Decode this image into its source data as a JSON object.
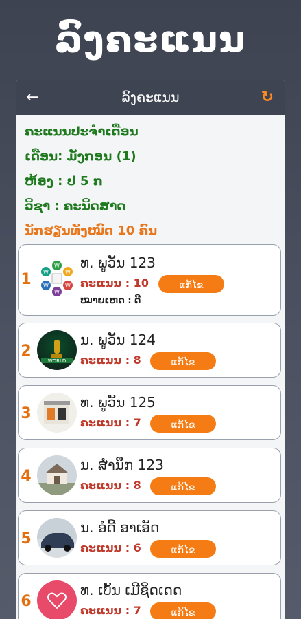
{
  "hero_title": "ລົງຄະແນນ",
  "appbar": {
    "back": "←",
    "title": "ລົງຄະແນນ",
    "refresh": "↻"
  },
  "info": {
    "monthly_heading": "ຄະແນນປະຈຳເດືອນ",
    "month": "ເດືອນ: ມັງກອນ (1)",
    "room": "ຫ້ອງ : ປ 5 ກ",
    "subject": "ວິຊາ :  ຄະນິດສາດ",
    "total_students": "ນັກຮຽນທັງໝົດ 10 ຄົນ"
  },
  "students": [
    {
      "no": "1",
      "name": "ທ. ພູວັນ 123",
      "score": "ຄະແນນ : 10",
      "edit": "ແກ້ໄຂ",
      "note": "ໝາຍເຫດ : ດີ"
    },
    {
      "no": "2",
      "name": "ນ. ພູວັນ 124",
      "score": "ຄະແນນ : 8",
      "edit": "ແກ້ໄຂ"
    },
    {
      "no": "3",
      "name": "ທ. ພູວັນ 125",
      "score": "ຄະແນນ : 7",
      "edit": "ແກ້ໄຂ"
    },
    {
      "no": "4",
      "name": "ນ. ສຳນຶກ 123",
      "score": "ຄະແນນ : 8",
      "edit": "ແກ້ໄຂ"
    },
    {
      "no": "5",
      "name": "ນ. ອໍດີ້ ອາເອັດ",
      "score": "ຄະແນນ : 6",
      "edit": "ແກ້ໄຂ"
    },
    {
      "no": "6",
      "name": "ທ. ເບັ້ນ ເມີຊິດເດດ",
      "score": "ຄະແນນ : 7",
      "edit": "ແກ້ໄຂ"
    }
  ],
  "colors": {
    "accent": "#f57c14",
    "header": "#3f4452",
    "green_text": "#1f7a1f",
    "score_text": "#c0392b"
  }
}
